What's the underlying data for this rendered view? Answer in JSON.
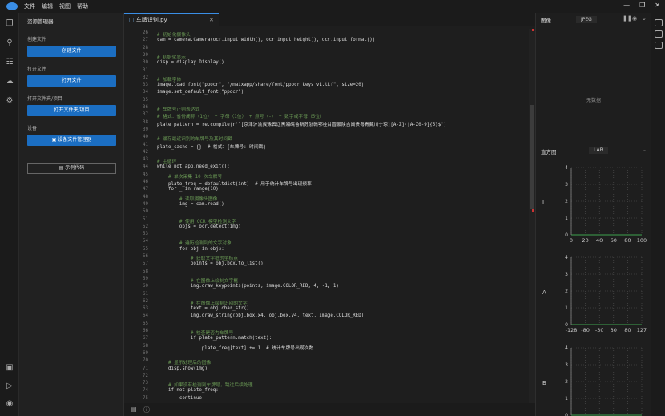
{
  "menu": [
    "文件",
    "编辑",
    "视图",
    "帮助"
  ],
  "sidebar": {
    "title": "资源管理器",
    "create_label": "创建文件",
    "create_btn": "创建文件",
    "open_label": "打开文件",
    "open_btn": "打开文件",
    "openfolder_label": "打开文件夹/项目",
    "openfolder_btn": "打开文件夹/项目",
    "device_label": "设备",
    "device_btn": "设备文件管理器",
    "example_btn": "示例代码"
  },
  "editor": {
    "tab": "车牌识别.py",
    "lines": [
      {
        "n": "26",
        "t": "# 初始化摄像头",
        "c": "cm"
      },
      {
        "n": "27",
        "t": "cam = camera.Camera(ocr.input_width(), ocr.input_height(), ocr.input_format())",
        "c": ""
      },
      {
        "n": "28",
        "t": "",
        "c": ""
      },
      {
        "n": "29",
        "t": "# 初始化显示",
        "c": "cm"
      },
      {
        "n": "30",
        "t": "disp = display.Display()",
        "c": ""
      },
      {
        "n": "31",
        "t": "",
        "c": ""
      },
      {
        "n": "32",
        "t": "# 加载字体",
        "c": "cm"
      },
      {
        "n": "33",
        "t": "image.load_font(\"ppocr\", \"/maixapp/share/font/ppocr_keys_v1.ttf\", size=20)",
        "c": ""
      },
      {
        "n": "34",
        "t": "image.set_default_font(\"ppocr\")",
        "c": ""
      },
      {
        "n": "35",
        "t": "",
        "c": ""
      },
      {
        "n": "36",
        "t": "# 车牌号正则表达式",
        "c": "cm"
      },
      {
        "n": "37",
        "t": "# 格式：省份简称（1位） + 字母（1位） + 点号（-） + 数字或字母（5位）",
        "c": "cm"
      },
      {
        "n": "38",
        "t": "plate_pattern = re.compile(r'^[京津沪渝冀豫云辽黑湘皖鲁新苏浙赣鄂桂甘晋蒙陕吉闽贵粤青藏川宁琼][A-Z]·[A-Z0-9]{5}$')",
        "c": ""
      },
      {
        "n": "39",
        "t": "",
        "c": ""
      },
      {
        "n": "40",
        "t": "# 缓存最近识别的车牌号及其时间戳",
        "c": "cm"
      },
      {
        "n": "41",
        "t": "plate_cache = {}  # 格式：{车牌号: 时间戳}",
        "c": ""
      },
      {
        "n": "42",
        "t": "",
        "c": ""
      },
      {
        "n": "43",
        "t": "# 主循环",
        "c": "cm"
      },
      {
        "n": "44",
        "t": "while not app.need_exit():",
        "c": ""
      },
      {
        "n": "45",
        "t": "    # 单次采集 10 次车牌号",
        "c": "cm"
      },
      {
        "n": "46",
        "t": "    plate_freq = defaultdict(int)  # 用于统计车牌号出现频率",
        "c": ""
      },
      {
        "n": "47",
        "t": "    for _ in range(10):",
        "c": ""
      },
      {
        "n": "48",
        "t": "        # 读取摄像头图像",
        "c": "cm"
      },
      {
        "n": "49",
        "t": "        img = cam.read()",
        "c": ""
      },
      {
        "n": "50",
        "t": "",
        "c": ""
      },
      {
        "n": "51",
        "t": "        # 使用 OCR 模型检测文字",
        "c": "cm"
      },
      {
        "n": "52",
        "t": "        objs = ocr.detect(img)",
        "c": ""
      },
      {
        "n": "53",
        "t": "",
        "c": ""
      },
      {
        "n": "54",
        "t": "        # 遍历检测到的文字对象",
        "c": "cm"
      },
      {
        "n": "55",
        "t": "        for obj in objs:",
        "c": ""
      },
      {
        "n": "56",
        "t": "            # 获取文字框的坐标点",
        "c": "cm"
      },
      {
        "n": "57",
        "t": "            points = obj.box.to_list()",
        "c": ""
      },
      {
        "n": "58",
        "t": "",
        "c": ""
      },
      {
        "n": "59",
        "t": "            # 在图像上绘制文字框",
        "c": "cm"
      },
      {
        "n": "60",
        "t": "            img.draw_keypoints(points, image.COLOR_RED, 4, -1, 1)",
        "c": ""
      },
      {
        "n": "61",
        "t": "",
        "c": ""
      },
      {
        "n": "62",
        "t": "            # 在图像上绘制识别的文字",
        "c": "cm"
      },
      {
        "n": "63",
        "t": "            text = obj.char_str()",
        "c": ""
      },
      {
        "n": "64",
        "t": "            img.draw_string(obj.box.x4, obj.box.y4, text, image.COLOR_RED)",
        "c": ""
      },
      {
        "n": "65",
        "t": "",
        "c": ""
      },
      {
        "n": "66",
        "t": "            # 检查是否为车牌号",
        "c": "cm"
      },
      {
        "n": "67",
        "t": "            if plate_pattern.match(text):",
        "c": ""
      },
      {
        "n": "68",
        "t": "                plate_freq[text] += 1  # 统计车牌号出现次数",
        "c": ""
      },
      {
        "n": "69",
        "t": "",
        "c": ""
      },
      {
        "n": "70",
        "t": "    # 显示处理后的图像",
        "c": "cm"
      },
      {
        "n": "71",
        "t": "    disp.show(img)",
        "c": ""
      },
      {
        "n": "72",
        "t": "",
        "c": ""
      },
      {
        "n": "73",
        "t": "    # 如果没有检测到车牌号，跳过后续处理",
        "c": "cm"
      },
      {
        "n": "74",
        "t": "    if not plate_freq:",
        "c": ""
      },
      {
        "n": "75",
        "t": "        continue",
        "c": ""
      }
    ]
  },
  "right": {
    "image_title": "图像",
    "format": "JPEG",
    "nodata": "无数据",
    "hist_title": "直方图",
    "color_space": "LAB",
    "channels": [
      {
        "name": "L",
        "yticks": [
          "4",
          "3",
          "2",
          "1",
          "0"
        ],
        "xticks": [
          "0",
          "20",
          "40",
          "60",
          "80",
          "100"
        ]
      },
      {
        "name": "A",
        "yticks": [
          "4",
          "3",
          "2",
          "1",
          "0"
        ],
        "xticks": [
          "-128",
          "-80",
          "-30",
          "30",
          "80",
          "127"
        ]
      },
      {
        "name": "B",
        "yticks": [
          "4",
          "3",
          "2",
          "1",
          "0"
        ],
        "xticks": [
          "-128",
          "-80",
          "-30",
          "30",
          "80",
          "127"
        ]
      }
    ]
  }
}
